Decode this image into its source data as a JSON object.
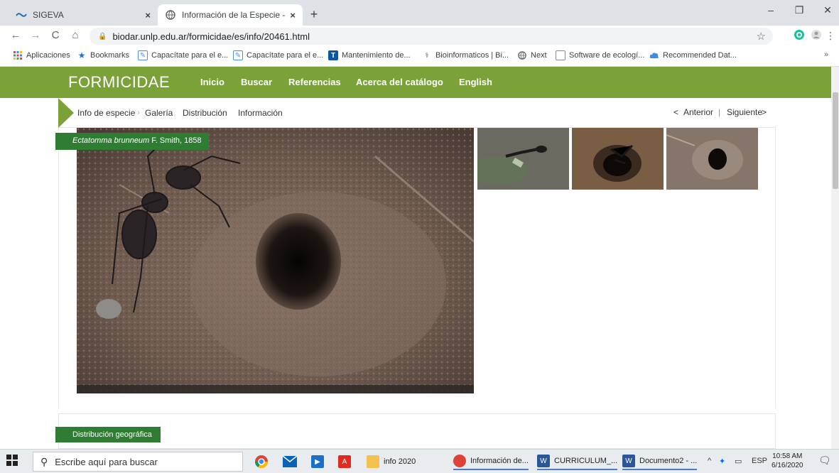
{
  "tabs": [
    {
      "title": "SIGEVA",
      "close": "×"
    },
    {
      "title": "Información de la Especie - Ectat",
      "close": "×"
    }
  ],
  "new_tab": "+",
  "window_controls": {
    "minimize": "–",
    "restore": "❐",
    "close": "✕"
  },
  "toolbar": {
    "back": "←",
    "forward": "→",
    "reload": "C",
    "home": "⌂",
    "url": "biodar.unlp.edu.ar/formicidae/es/info/20461.html",
    "bookmark_star": "☆"
  },
  "bookmarks": [
    {
      "label": "Aplicaciones"
    },
    {
      "label": "Bookmarks"
    },
    {
      "label": "Capacítate para el e..."
    },
    {
      "label": "Capacítate para el e..."
    },
    {
      "label": "Mantenimiento de..."
    },
    {
      "label": "Bioinformaticos | Bi..."
    },
    {
      "label": "Next"
    },
    {
      "label": "Software de ecologí..."
    },
    {
      "label": "Recommended Dat..."
    }
  ],
  "bookmarks_overflow": "»",
  "site": {
    "brand": "FORMICIDAE",
    "nav": [
      "Inicio",
      "Buscar",
      "Referencias",
      "Acerca del catálogo",
      "English"
    ]
  },
  "subnav": {
    "items": [
      "Info de especie",
      "Galería",
      "Distribución",
      "Información"
    ],
    "prev": "Anterior",
    "divider": "|",
    "next": "Siguiente",
    "prev_arrow": "<",
    "next_arrow": ">"
  },
  "species": {
    "name": "Ectatomma brunneum",
    "author": "F. Smith, 1858"
  },
  "distribution_label": "Distribución geográfica",
  "taskbar": {
    "search_placeholder": "Escribe aquí para buscar",
    "apps": [
      {
        "label": "info 2020"
      },
      {
        "label": "Información de..."
      },
      {
        "label": "CURRICULUM_..."
      },
      {
        "label": "Documento2 - ..."
      }
    ],
    "tray_chevron": "^",
    "language": "ESP",
    "time": "10:58 AM",
    "date": "6/16/2020"
  },
  "colors": {
    "brand_green": "#7aa239",
    "label_green": "#2e7d32"
  }
}
